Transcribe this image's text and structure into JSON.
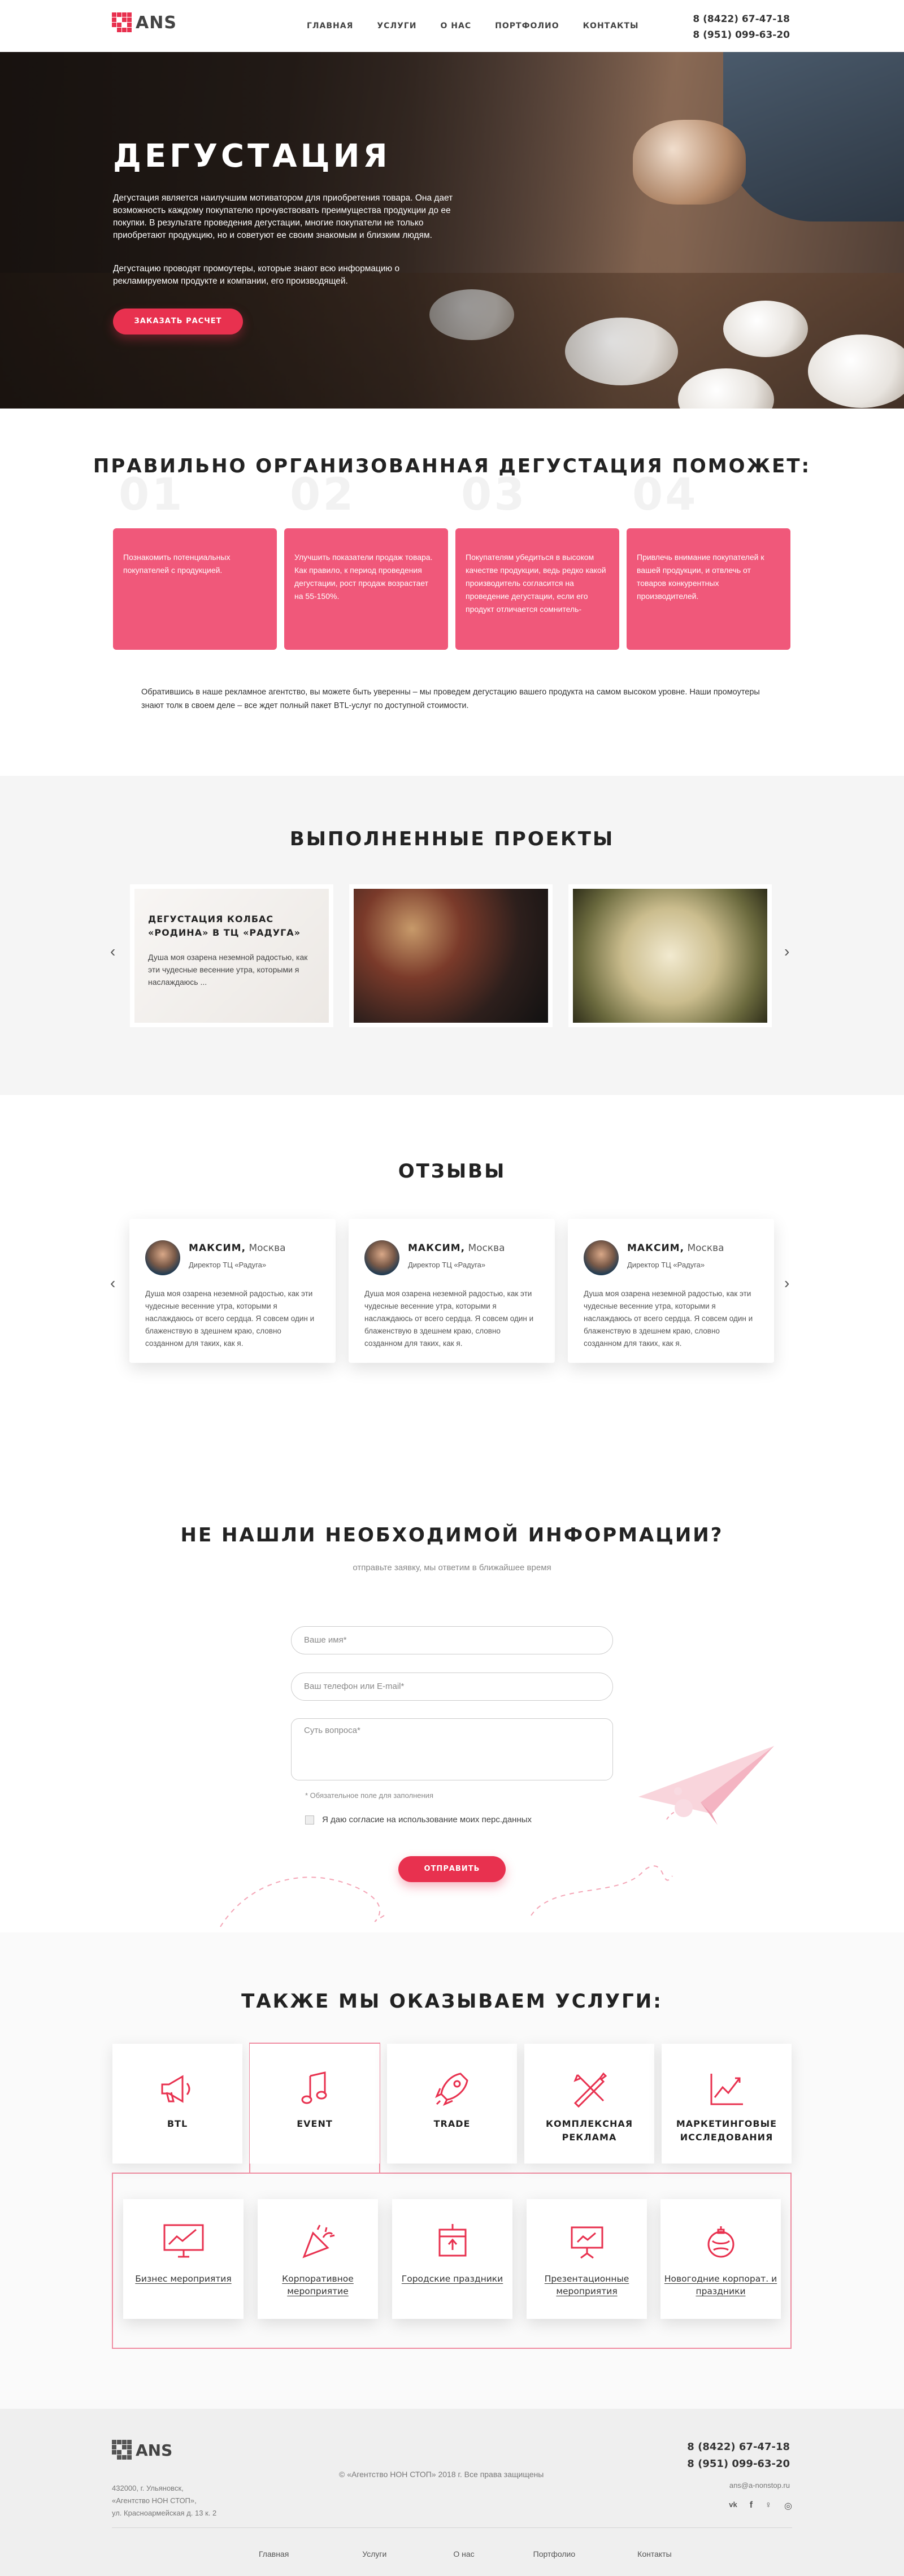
{
  "header": {
    "logo_text": "ANS",
    "nav": [
      "ГЛАВНАЯ",
      "УСЛУГИ",
      "О НАС",
      "ПОРТФОЛИО",
      "КОНТАКТЫ"
    ],
    "phone1": "8 (8422) 67-47-18",
    "phone2": "8 (951) 099-63-20"
  },
  "hero": {
    "title": "ДЕГУСТАЦИЯ",
    "p1": "Дегустация является наилучшим мотиватором для приобретения товара. Она дает возможность каждому покупателю прочувствовать преимущества продукции до ее покупки. В результате проведения дегустации, многие покупатели не только приобретают продукцию, но и советуют ее своим знакомым и близким людям.",
    "p2": "Дегустацию проводят промоутеры, которые знают всю информацию о рекламируемом продукте и компании, его производящей.",
    "button": "ЗАКАЗАТЬ РАСЧЕТ"
  },
  "benefits": {
    "title": "ПРАВИЛЬНО ОРГАНИЗОВАННАЯ ДЕГУСТАЦИЯ ПОМОЖЕТ:",
    "items": [
      {
        "num": "01",
        "text": "Познакомить потенциальных покупателей с продукцией."
      },
      {
        "num": "02",
        "text": "Улучшить показатели продаж товара. Как правило, к период проведения дегустации, рост продаж возрастает на 55-150%."
      },
      {
        "num": "03",
        "text": "Покупателям убедиться в высоком качестве продукции, ведь редко какой производитель согласится на проведение дегустации, если его продукт отличается сомнитель-"
      },
      {
        "num": "04",
        "text": "Привлечь внимание покупателей к вашей продукции, и отвлечь от товаров конкурентных производителей."
      }
    ],
    "note": "Обратившись в наше рекламное агентство, вы можете быть уверенны – мы проведем дегустацию вашего продукта на самом высоком уровне. Наши промоутеры знают толк в своем деле – все ждет полный пакет BTL-услуг по доступной стоимости."
  },
  "projects": {
    "title": "ВЫПОЛНЕННЫЕ ПРОЕКТЫ",
    "featured_title": "ДЕГУСТАЦИЯ КОЛБАС «РОДИНА» В ТЦ «РАДУГА»",
    "featured_text": "Душа моя озарена неземной радостью, как эти чудесные весенние утра, которыми я наслаждаюсь ..."
  },
  "reviews": {
    "title": "ОТЗЫВЫ",
    "items": [
      {
        "name": "МАКСИМ,",
        "city": "Москва",
        "role": "Директор ТЦ «Радуга»",
        "text": "Душа моя озарена неземной радостью, как эти чудесные весенние утра, которыми я наслаждаюсь от всего сердца. Я совсем один и блаженствую в здешнем краю, словно созданном для таких, как я."
      },
      {
        "name": "МАКСИМ,",
        "city": "Москва",
        "role": "Директор ТЦ «Радуга»",
        "text": "Душа моя озарена неземной радостью, как эти чудесные весенние утра, которыми я наслаждаюсь от всего сердца. Я совсем один и блаженствую в здешнем краю, словно созданном для таких, как я."
      },
      {
        "name": "МАКСИМ,",
        "city": "Москва",
        "role": "Директор ТЦ «Радуга»",
        "text": "Душа моя озарена неземной радостью, как эти чудесные весенние утра, которыми я наслаждаюсь от всего сердца. Я совсем один и блаженствую в здешнем краю, словно созданном для таких, как я."
      }
    ]
  },
  "form": {
    "title": "НЕ НАШЛИ НЕОБХОДИМОЙ ИНФОРМАЦИИ?",
    "subtitle": "отправьте заявку, мы ответим в ближайшее время",
    "name_placeholder": "Ваше имя*",
    "contact_placeholder": "Ваш телефон или E-mail*",
    "question_placeholder": "Суть вопроса*",
    "required_hint": "* Обязательное поле для заполнения",
    "consent": "Я даю согласие на использование моих перс.данных",
    "submit": "ОТПРАВИТЬ"
  },
  "services": {
    "title": "ТАКЖЕ МЫ ОКАЗЫВАЕМ УСЛУГИ:",
    "items": [
      {
        "label": "BTL",
        "icon": "megaphone-icon"
      },
      {
        "label": "EVENT",
        "icon": "music-note-icon"
      },
      {
        "label": "TRADE",
        "icon": "rocket-icon"
      },
      {
        "label": "КОМПЛЕКСНАЯ РЕКЛАМА",
        "icon": "tools-icon"
      },
      {
        "label": "МАРКЕТИНГОВЫЕ ИССЛЕДОВАНИЯ",
        "icon": "chart-icon"
      }
    ],
    "event_items": [
      {
        "label": "Бизнес мероприятия",
        "icon": "monitor-chart-icon"
      },
      {
        "label": "Корпоративное мероприятие",
        "icon": "party-popper-icon"
      },
      {
        "label": "Городские праздники",
        "icon": "city-flag-icon"
      },
      {
        "label": "Презентационные мероприятия",
        "icon": "presentation-icon"
      },
      {
        "label": "Новогодние корпорат. и праздники",
        "icon": "ornament-icon"
      }
    ]
  },
  "footer": {
    "logo_text": "ANS",
    "address1": "432000, г. Ульяновск,",
    "address2": "«Агентство НОН СТОП»,",
    "address3": "ул. Красноармейская д. 13 к. 2",
    "copyright": "© «Агентство НОН СТОП» 2018 г. Все права защищены",
    "phone1": "8 (8422) 67-47-18",
    "phone2": "8 (951) 099-63-20",
    "email": "ans@a-nonstop.ru",
    "nav": [
      "Главная",
      "Услуги",
      "О нас",
      "Портфолио",
      "Контакты"
    ],
    "accent": "#e8314f"
  }
}
